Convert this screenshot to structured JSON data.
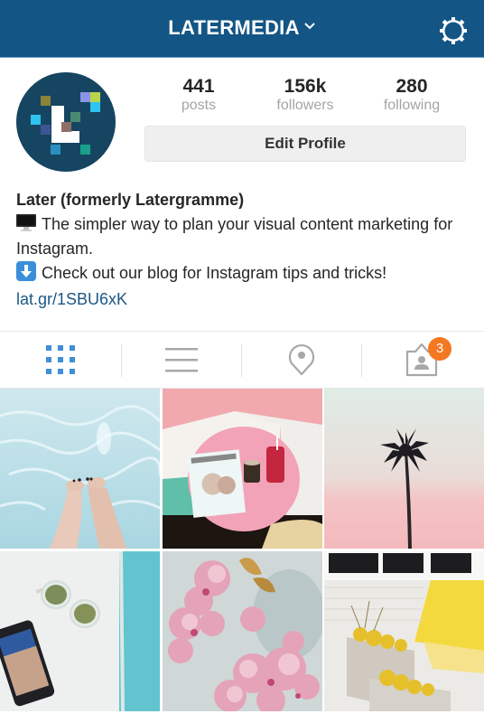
{
  "header": {
    "account_name": "LATERMEDIA",
    "dropdown_icon": "chevron-down-icon",
    "settings_icon": "gear-icon",
    "bg_color": "#135585"
  },
  "profile": {
    "avatar_icon": "later-logo",
    "stats": [
      {
        "value": "441",
        "label": "posts"
      },
      {
        "value": "156k",
        "label": "followers"
      },
      {
        "value": "280",
        "label": "following"
      }
    ],
    "edit_button_label": "Edit Profile"
  },
  "bio": {
    "name": "Later (formerly Latergramme)",
    "line1_emoji": "desktop-computer-icon",
    "line1": "The simpler way to plan your visual content marketing for Instagram.",
    "line2_emoji": "down-arrow-icon",
    "line2": "Check out our blog for Instagram tips and tricks!",
    "link": "lat.gr/1SBU6xK",
    "link_color": "#1c5784"
  },
  "tabs": [
    {
      "name": "grid-view",
      "icon": "grid-icon",
      "active": true
    },
    {
      "name": "list-view",
      "icon": "list-icon",
      "active": false
    },
    {
      "name": "map-view",
      "icon": "location-pin-icon",
      "active": false
    },
    {
      "name": "tagged-photos",
      "icon": "tagged-person-icon",
      "active": false,
      "badge": "3"
    }
  ],
  "colors": {
    "active_tab": "#3f8fd6",
    "inactive_tab": "#a8a8a8",
    "badge": "#f47721"
  },
  "photos": [
    {
      "description": "feet in swimming pool"
    },
    {
      "description": "pink table with magazine and drinks"
    },
    {
      "description": "palm tree against pastel sky"
    },
    {
      "description": "sunglasses and phone on white table"
    },
    {
      "description": "pink cherry blossoms"
    },
    {
      "description": "yellow flowers in wooden planters"
    }
  ]
}
